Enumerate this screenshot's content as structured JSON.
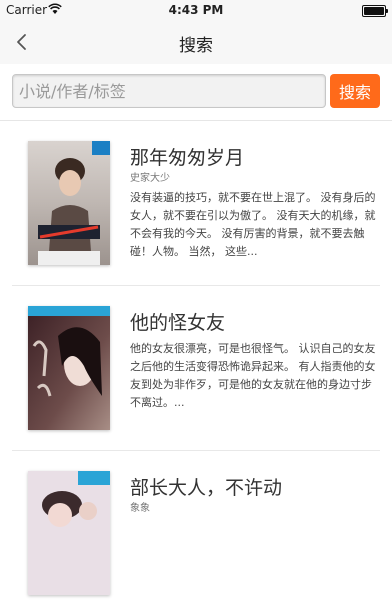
{
  "status": {
    "carrier": "Carrier",
    "time": "4:43 PM"
  },
  "nav": {
    "title": "搜索"
  },
  "search": {
    "placeholder": "小说/作者/标签",
    "button_label": "搜索"
  },
  "books": [
    {
      "title": "那年匆匆岁月",
      "author": "史家大少",
      "description": "没有装逼的技巧，就不要在世上混了。 没有身后的女人，就不要在引以为傲了。 没有天大的机缘，就不会有我的今天。 没有厉害的背景，就不要去触碰！人物。 当然， 这些...",
      "cover_title": "那年匆匆岁月"
    },
    {
      "title": "他的怪女友",
      "author": "",
      "description": "他的女友很漂亮，可是也很怪气。 认识自己的女友之后他的生活变得恐怖诡异起来。 有人指责他的女友到处为非作歹，可是他的女友就在他的身边寸步不离过。...",
      "cover_title": "他的怪女友"
    },
    {
      "title": "部长大人，不许动",
      "author": "象象",
      "description": "",
      "cover_title": ""
    }
  ],
  "colors": {
    "accent": "#ff6a1a",
    "bar_bg": "#f7f7f7",
    "divider": "#e8e8e8"
  }
}
